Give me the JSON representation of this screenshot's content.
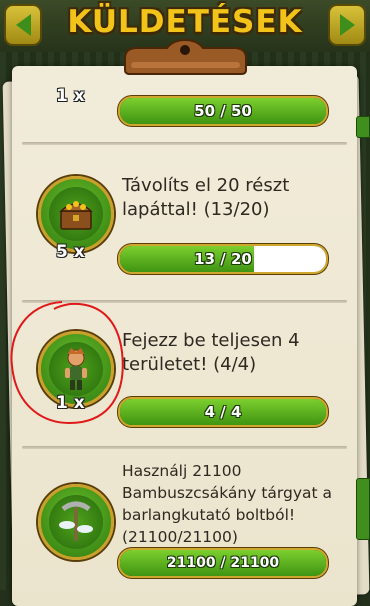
{
  "header": {
    "title": "KÜLDETÉSEK"
  },
  "quests": [
    {
      "count": "1 x",
      "progress_label": "50 / 50",
      "progress": 1.0,
      "icon": "reward-icon"
    },
    {
      "text": "Távolíts el 20 részt lapáttal! (13/20)",
      "count": "5 x",
      "progress_label": "13 / 20",
      "progress": 0.65,
      "icon": "treasure-chest-icon"
    },
    {
      "text": "Fejezz be teljesen 4 területet! (4/4)",
      "count": "1 x",
      "progress_label": "4 / 4",
      "progress": 1.0,
      "icon": "explorer-character-icon"
    },
    {
      "text": "Használj 21100 Bambuszcsákány tárgyat a barlangkutató boltból! (21100/21100)",
      "progress_label": "21100 / 21100",
      "progress": 1.0,
      "icon": "bamboo-pickaxe-icon"
    }
  ],
  "colors": {
    "accent_green": "#3f9412",
    "gold": "#d0a72e",
    "annotation_red": "#e01919"
  }
}
